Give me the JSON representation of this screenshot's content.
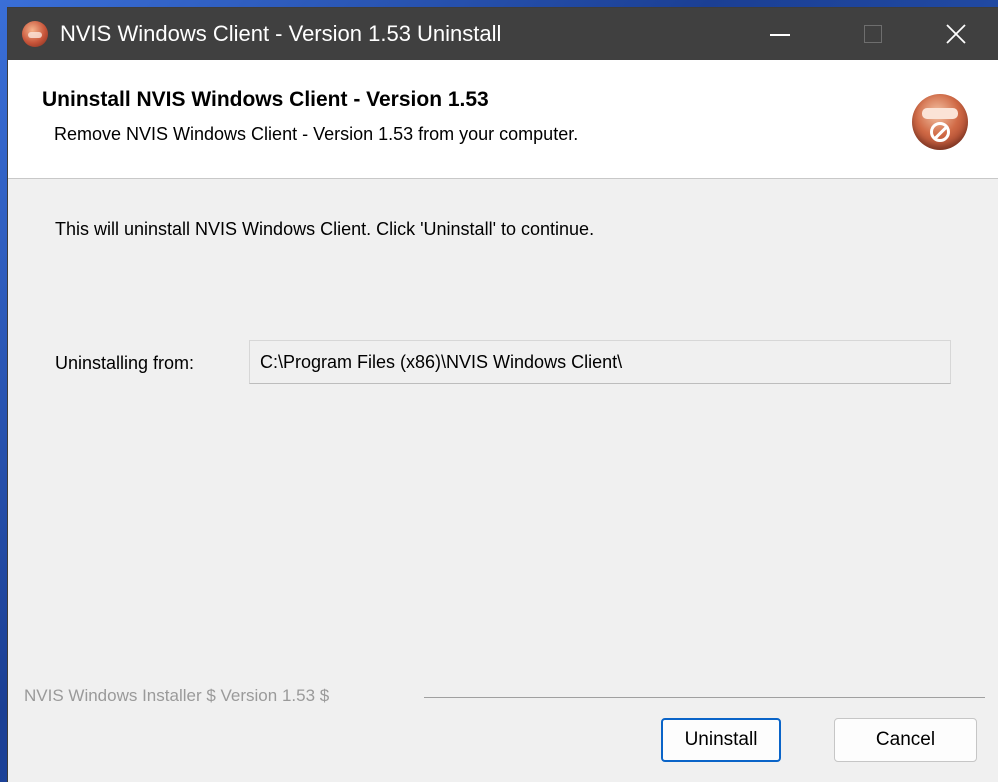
{
  "window": {
    "title": "NVIS Windows Client - Version 1.53 Uninstall",
    "controls": {
      "minimize_icon": "minimize-icon",
      "maximize_icon": "maximize-icon",
      "close_icon": "close-icon"
    }
  },
  "header": {
    "title": "Uninstall NVIS Windows Client - Version 1.53",
    "subtitle": "Remove NVIS Windows Client - Version 1.53 from your computer.",
    "icon": "uninstall-disc-icon"
  },
  "body": {
    "message": "This will uninstall NVIS Windows Client.  Click 'Uninstall' to continue.",
    "uninstall_from_label": "Uninstalling from:",
    "uninstall_from_value": "C:\\Program Files (x86)\\NVIS Windows Client\\"
  },
  "footer": {
    "branding": "NVIS Windows Installer $ Version 1.53 $",
    "uninstall_label": "Uninstall",
    "cancel_label": "Cancel"
  },
  "colors": {
    "titlebar": "#404040",
    "accent": "#0a64c8",
    "dialog_bg": "#f0f0f0",
    "header_bg": "#ffffff"
  }
}
